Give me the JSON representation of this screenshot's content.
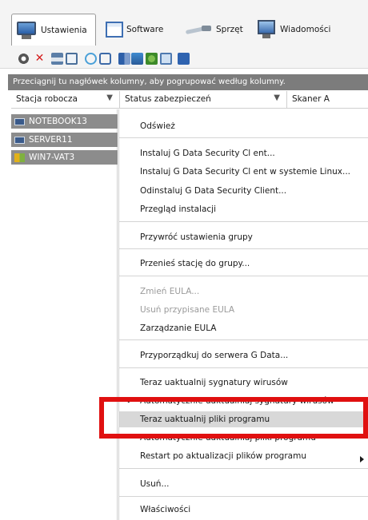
{
  "tabs": [
    {
      "label": "Ustawienia",
      "icon": "monitor-icon"
    },
    {
      "label": "Software",
      "icon": "window-icon"
    },
    {
      "label": "Sprzęt",
      "icon": "cable-icon"
    },
    {
      "label": "Wiadomości",
      "icon": "message-monitor-icon"
    }
  ],
  "toolbar": {
    "icons": [
      "settings-icon",
      "delete-icon",
      "print-icon",
      "print-preview-icon",
      "refresh-icon",
      "filter-icon",
      "layout-icon",
      "chart-icon",
      "tools-icon",
      "report-icon",
      "export-icon"
    ]
  },
  "group_banner": "Przeciągnij tu nagłówek kolumny, aby pogrupować według kolumny.",
  "columns": [
    "Stacja robocza",
    "Status zabezpieczeń",
    "Skaner A"
  ],
  "workstations": [
    "NOTEBOOK13",
    "SERVER11",
    "WIN7-VAT3"
  ],
  "menu": {
    "refresh": "Odśwież",
    "install_client": "Instaluj G Data Security Cl ent...",
    "install_linux": "Instaluj G Data Security Cl ent w systemie Linux...",
    "uninstall_client": "Odinstaluj G Data Security Client...",
    "install_overview": "Przegląd instalacji",
    "restore_group": "Przywróć ustawienia grupy",
    "move_station": "Przenieś stację do grupy...",
    "change_eula": "Zmień EULA...",
    "remove_eula": "Usuń przypisane EULA",
    "manage_eula": "Zarządzanie EULA",
    "assign_server": "Przyporządkuj do serwera G Data...",
    "update_signatures": "Teraz uaktualnij sygnatury wirusów",
    "auto_signatures": "Automatycznie uaktualniaj sygnatury wirusów",
    "update_program": "Teraz uaktualnij pliki programu",
    "auto_program": "Automatycznie uaktualniaj pliki programu",
    "restart_after_update": "Restart po aktualizacji plików programu",
    "delete": "Usuń...",
    "properties": "Właściwości"
  },
  "colors": {
    "highlight_box": "#e01010",
    "banner": "#7c7c7c",
    "row_bg": "#8c8c8c"
  }
}
